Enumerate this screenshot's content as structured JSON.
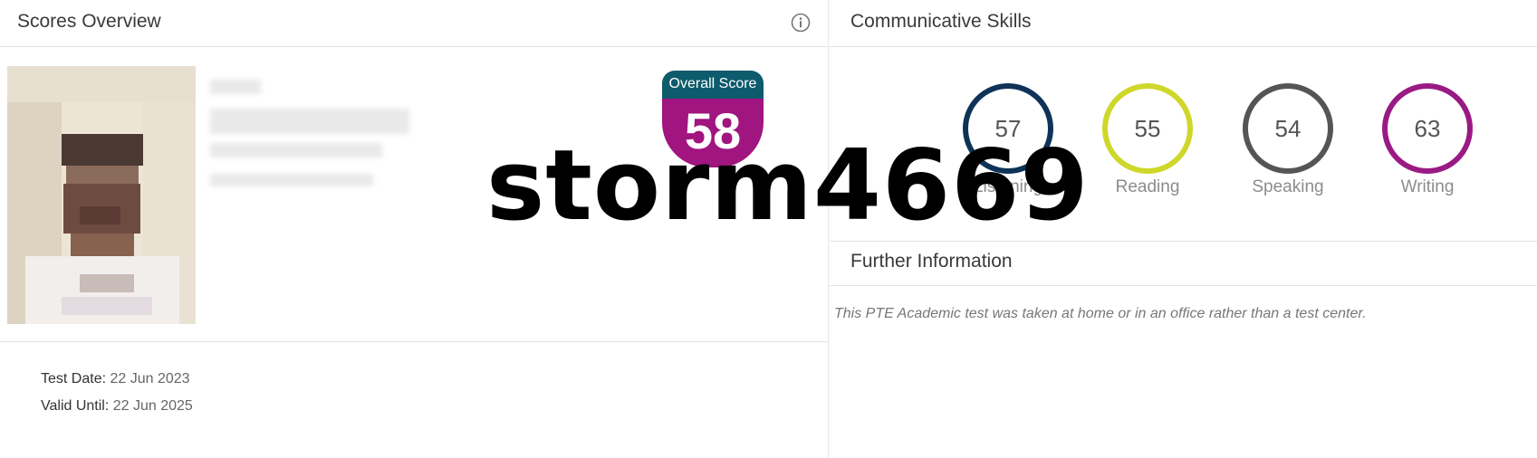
{
  "scores_overview": {
    "title": "Scores Overview",
    "info_icon": "info-circle-icon",
    "overall_score_label": "Overall Score",
    "overall_score": "58",
    "test_date_label": "Test Date:",
    "test_date": "22 Jun 2023",
    "valid_until_label": "Valid Until:",
    "valid_until": "22 Jun 2025"
  },
  "communicative_skills": {
    "title": "Communicative Skills",
    "skills": [
      {
        "label": "Listening",
        "score": "57",
        "color": "#0f3358"
      },
      {
        "label": "Reading",
        "score": "55",
        "color": "#cfd72a"
      },
      {
        "label": "Speaking",
        "score": "54",
        "color": "#555555"
      },
      {
        "label": "Writing",
        "score": "63",
        "color": "#9a1a84"
      }
    ]
  },
  "further_information": {
    "title": "Further Information",
    "note": "This PTE Academic test was taken at home or in an office rather than a test center."
  },
  "watermark": "storm4669",
  "colors": {
    "overall_header": "#0d5b6c",
    "overall_body": "#a0157f"
  }
}
